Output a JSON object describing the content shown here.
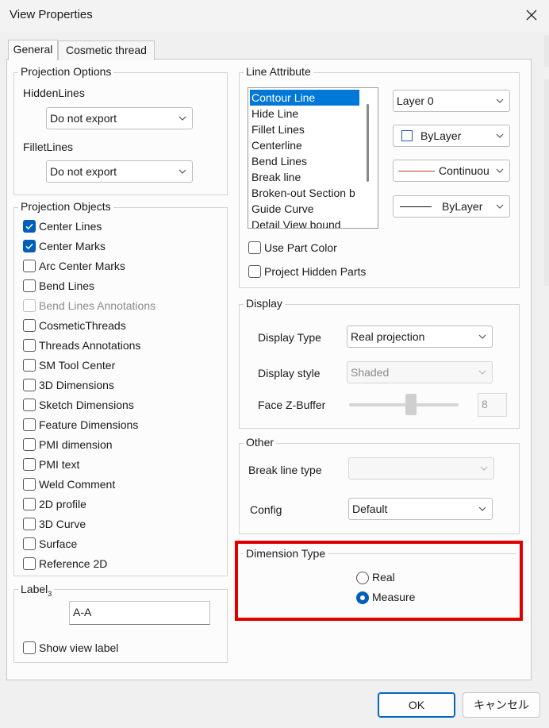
{
  "window": {
    "title": "View Properties"
  },
  "tabs": [
    {
      "label": "General",
      "active": true
    },
    {
      "label": "Cosmetic thread",
      "active": false
    }
  ],
  "projection_options": {
    "title": "Projection Options",
    "hidden_lines_label": "HiddenLines",
    "hidden_lines_value": "Do not export",
    "fillet_lines_label": "FilletLines",
    "fillet_lines_value": "Do not export"
  },
  "projection_objects": {
    "title": "Projection Objects",
    "items": [
      {
        "label": "Center Lines",
        "checked": true,
        "enabled": true
      },
      {
        "label": "Center Marks",
        "checked": true,
        "enabled": true
      },
      {
        "label": "Arc Center Marks",
        "checked": false,
        "enabled": true
      },
      {
        "label": "Bend Lines",
        "checked": false,
        "enabled": true
      },
      {
        "label": "Bend Lines Annotations",
        "checked": false,
        "enabled": false
      },
      {
        "label": "CosmeticThreads",
        "checked": false,
        "enabled": true
      },
      {
        "label": "Threads Annotations",
        "checked": false,
        "enabled": true
      },
      {
        "label": "SM Tool Center",
        "checked": false,
        "enabled": true
      },
      {
        "label": "3D Dimensions",
        "checked": false,
        "enabled": true
      },
      {
        "label": "Sketch Dimensions",
        "checked": false,
        "enabled": true
      },
      {
        "label": "Feature Dimensions",
        "checked": false,
        "enabled": true
      },
      {
        "label": "PMI dimension",
        "checked": false,
        "enabled": true
      },
      {
        "label": "PMI text",
        "checked": false,
        "enabled": true
      },
      {
        "label": "Weld Comment",
        "checked": false,
        "enabled": true
      },
      {
        "label": "2D profile",
        "checked": false,
        "enabled": true
      },
      {
        "label": "3D Curve",
        "checked": false,
        "enabled": true
      },
      {
        "label": "Surface",
        "checked": false,
        "enabled": true
      },
      {
        "label": "Reference 2D",
        "checked": false,
        "enabled": true
      }
    ]
  },
  "label_group": {
    "title": "Label",
    "title_suffix": "3",
    "value": "A-A",
    "show_view_label": "Show view label",
    "show_view_label_checked": false
  },
  "line_attribute": {
    "title": "Line Attribute",
    "list_items": [
      "Contour Line",
      "Hide Line",
      "Fillet Lines",
      "Centerline",
      "Bend Lines",
      "Break line",
      "Broken-out Section b",
      "Guide Curve",
      "Detail View bound"
    ],
    "selected_index": 0,
    "layer_value": "Layer 0",
    "color_value": "ByLayer",
    "linetype_value": "Continuou",
    "lineweight_value": "ByLayer",
    "linetype_color": "#c0392b",
    "use_part_color": "Use Part Color",
    "project_hidden_parts": "Project Hidden Parts"
  },
  "display": {
    "title": "Display",
    "type_label": "Display Type",
    "type_value": "Real projection",
    "style_label": "Display style",
    "style_value": "Shaded",
    "zbuffer_label": "Face Z-Buffer",
    "zbuffer_value": "8"
  },
  "other": {
    "title": "Other",
    "break_line_label": "Break line type",
    "break_line_value": "",
    "config_label": "Config",
    "config_value": "Default"
  },
  "dimension_type": {
    "title": "Dimension Type",
    "options": [
      "Real",
      "Measure"
    ],
    "selected": "Measure",
    "highlight_color": "#e00000"
  },
  "buttons": {
    "ok": "OK",
    "cancel": "キャンセル"
  }
}
